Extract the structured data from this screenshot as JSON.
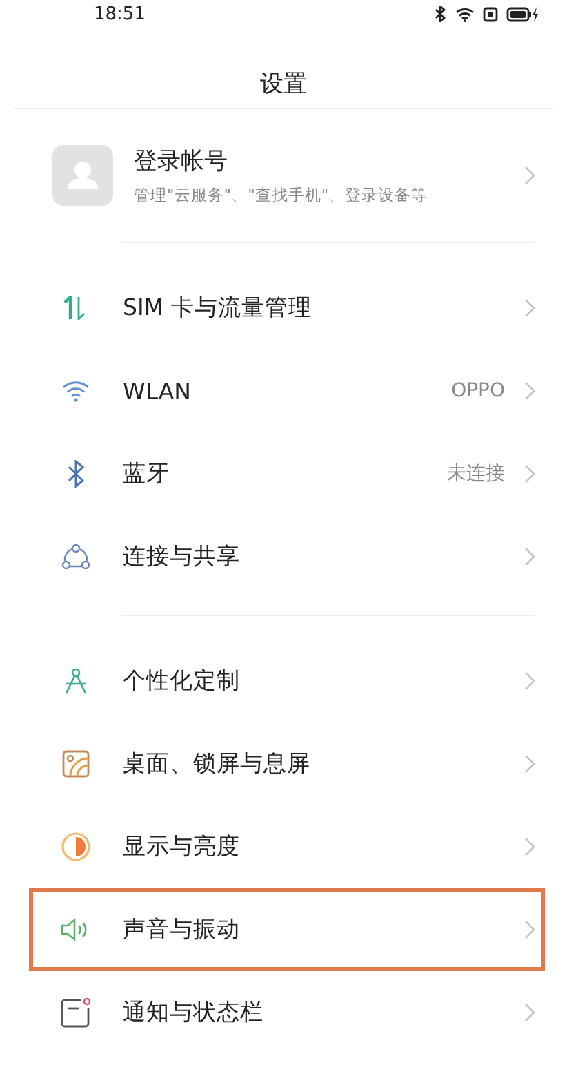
{
  "status_bar": {
    "time": "18:51"
  },
  "title": "设置",
  "account": {
    "name": "登录帐号",
    "subtitle": "管理\"云服务\"、\"查找手机\"、登录设备等"
  },
  "sections": [
    {
      "items": [
        {
          "label": "SIM 卡与流量管理",
          "highlighted": false
        },
        {
          "label": "WLAN",
          "value": "OPPO",
          "highlighted": false
        },
        {
          "label": "蓝牙",
          "value": "未连接",
          "highlighted": false
        },
        {
          "label": "连接与共享",
          "highlighted": false
        }
      ]
    },
    {
      "items": [
        {
          "label": "个性化定制",
          "highlighted": false
        },
        {
          "label": "桌面、锁屏与息屏",
          "highlighted": false
        },
        {
          "label": "显示与亮度",
          "highlighted": false
        },
        {
          "label": "声音与振动",
          "highlighted": true
        },
        {
          "label": "通知与状态栏",
          "highlighted": false
        }
      ]
    }
  ]
}
